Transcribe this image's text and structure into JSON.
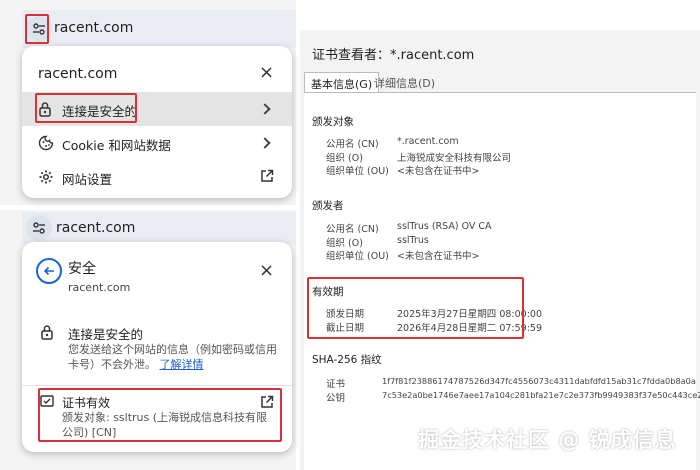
{
  "colors": {
    "highlight": "#d9313a",
    "link": "#1a62d6"
  },
  "top_popup": {
    "address": "racent.com",
    "title": "racent.com",
    "close": "×",
    "items": [
      {
        "icon": "lock-icon",
        "label": "连接是安全的"
      },
      {
        "icon": "cookie-icon",
        "label": "Cookie 和网站数据"
      },
      {
        "icon": "gear-icon",
        "label": "网站设置"
      }
    ]
  },
  "bottom_popup": {
    "address": "racent.com",
    "title": "安全",
    "subtitle": "racent.com",
    "close": "×",
    "secure_heading": "连接是安全的",
    "secure_desc": "您发送给这个网站的信息（例如密码或信用卡号）不会外泄。",
    "learn_more": "了解详情",
    "cert_heading": "证书有效",
    "cert_desc": "颁发对象: ssltrus (上海锐成信息科技有限公司) [CN]"
  },
  "cert_viewer": {
    "title": "证书查看者：*.racent.com",
    "tabs": [
      "基本信息(G)",
      "详细信息(D)"
    ],
    "issued_to": {
      "heading": "颁发对象",
      "rows": [
        {
          "k": "公用名 (CN)",
          "v": "*.racent.com"
        },
        {
          "k": "组织 (O)",
          "v": "上海锐成安全科技有限公司"
        },
        {
          "k": "组织单位 (OU)",
          "v": "<未包含在证书中>"
        }
      ]
    },
    "issued_by": {
      "heading": "颁发者",
      "rows": [
        {
          "k": "公用名 (CN)",
          "v": "sslTrus (RSA) OV CA"
        },
        {
          "k": "组织 (O)",
          "v": "sslTrus"
        },
        {
          "k": "组织单位 (OU)",
          "v": "<未包含在证书中>"
        }
      ]
    },
    "validity": {
      "heading": "有效期",
      "rows": [
        {
          "k": "颁发日期",
          "v": "2025年3月27日星期四 08:00:00"
        },
        {
          "k": "截止日期",
          "v": "2026年4月28日星期二 07:59:59"
        }
      ]
    },
    "fingerprints": {
      "heading": "SHA-256 指纹",
      "rows": [
        {
          "k": "证书",
          "v": "1f7f81f23886174787526d347fc4556073c4311dabfdfd15ab31c7fdda0b8a0a"
        },
        {
          "k": "公钥",
          "v": "7c53e2a0be1746e7aee17a104c281bfa21e7c2e373fb9949383f37e50c443ce2"
        }
      ]
    }
  },
  "watermark": "掘金技术社区 @ 锐成信息"
}
